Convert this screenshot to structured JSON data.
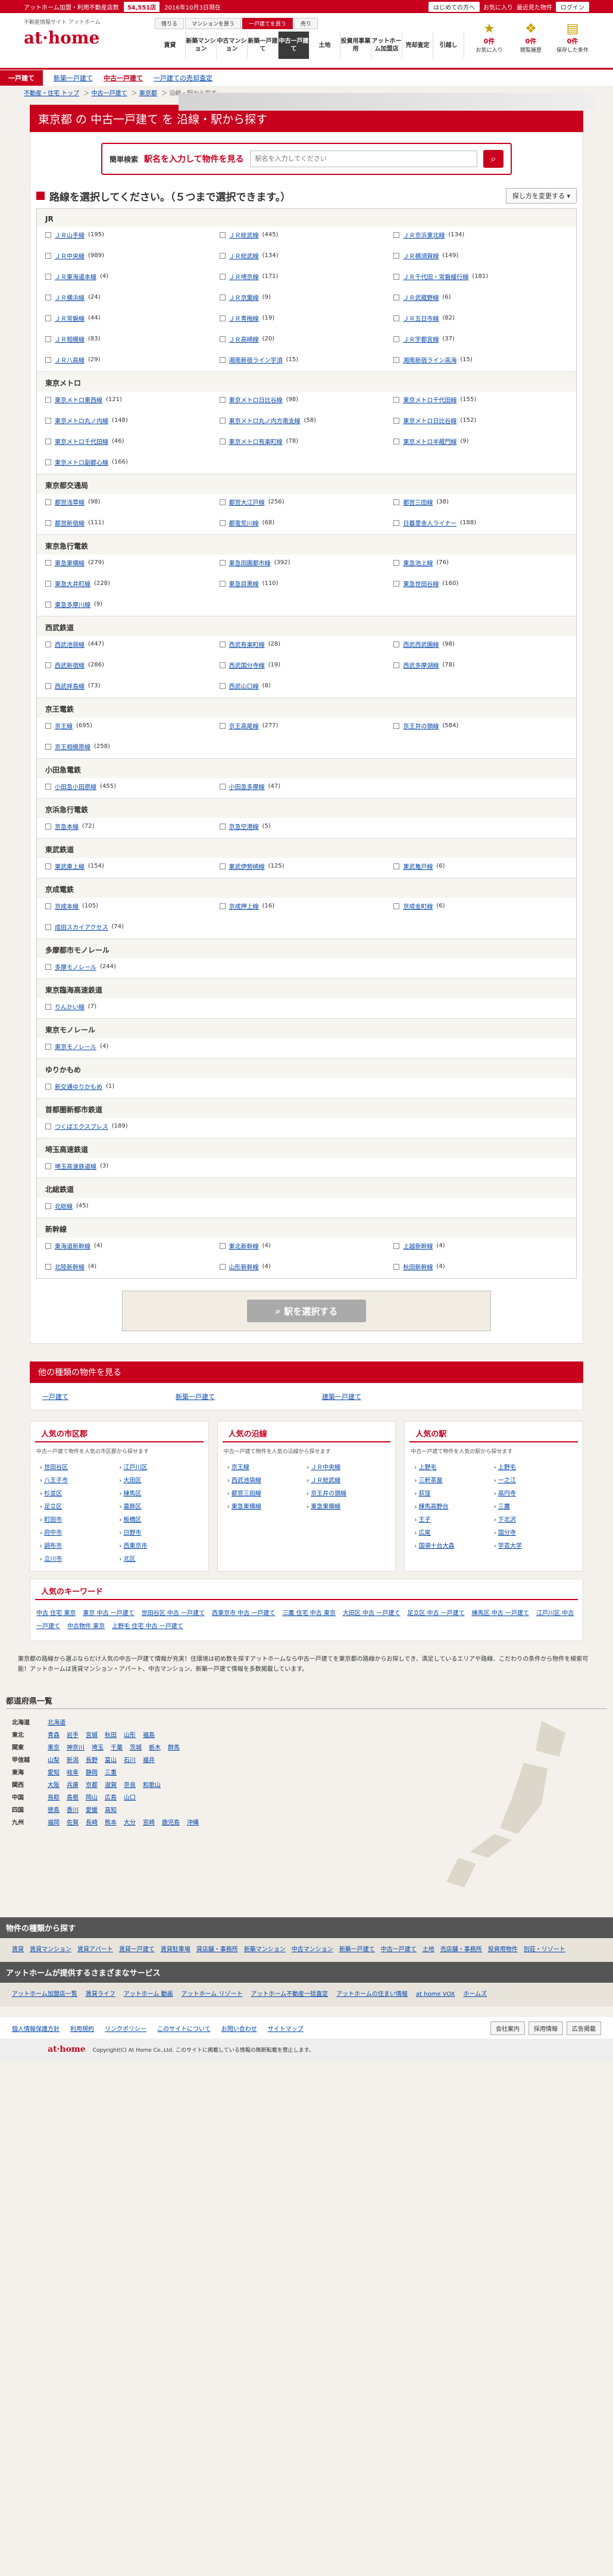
{
  "topbar": {
    "label": "アットホーム加盟・利用不動産店数",
    "count": "54,551店",
    "date": "2016年10月3日現在",
    "links": [
      "はじめての方へ",
      "お気に入り",
      "最近見た物件",
      "ログイン"
    ]
  },
  "header": {
    "sub": "不動産情報サイト アットホーム",
    "logo": "at·home",
    "top_tabs": [
      "借りる",
      "マンションを買う",
      "一戸建てを買う",
      "売り"
    ],
    "main_tabs": [
      "賃貸",
      "新築マンション",
      "中古マンション",
      "新築一戸建て",
      "中古一戸建て",
      "土地",
      "投資用事業用",
      "アットホーム加盟店",
      "売却査定",
      "引越し"
    ],
    "icons": [
      {
        "name": "お気に入り",
        "count": "0件"
      },
      {
        "name": "閲覧履歴",
        "count": "0件"
      },
      {
        "name": "保存した条件",
        "count": "0件"
      }
    ]
  },
  "subnav": {
    "tag": "一戸建て",
    "items": [
      "新築一戸建て",
      "中古一戸建て",
      "一戸建ての売却査定"
    ]
  },
  "breadcrumb": [
    "不動産・住宅 トップ",
    "中古一戸建て",
    "東京都",
    "沿線・駅から探す"
  ],
  "title": "東京都 の 中古一戸建て を 沿線・駅から探す",
  "search": {
    "label": "簡単検索",
    "label2": "駅名を入力して物件を見る",
    "placeholder": "駅名を入力してください"
  },
  "select": {
    "title": "路線を選択してください。（５つまで選択できます。）",
    "sort": "探し方を変更する"
  },
  "companies": [
    {
      "name": "JR",
      "lines": [
        [
          "ＪＲ山手線",
          "195"
        ],
        [
          "ＪＲ総武線",
          "445"
        ],
        [
          "ＪＲ京浜東北線",
          "134"
        ],
        [
          "ＪＲ中央線",
          "989"
        ],
        [
          "ＪＲ総武線",
          "134"
        ],
        [
          "ＪＲ横須賀線",
          "149"
        ],
        [
          "ＪＲ東海道本線",
          "4"
        ],
        [
          "ＪＲ埼京線",
          "171"
        ],
        [
          "ＪＲ千代田・常磐緩行線",
          "181"
        ],
        [
          "ＪＲ横浜線",
          "24"
        ],
        [
          "ＪＲ京葉線",
          "9"
        ],
        [
          "ＪＲ武蔵野線",
          "6"
        ],
        [
          "ＪＲ常磐線",
          "44"
        ],
        [
          "ＪＲ青梅線",
          "19"
        ],
        [
          "ＪＲ五日市線",
          "82"
        ],
        [
          "ＪＲ相模線",
          "83"
        ],
        [
          "ＪＲ高崎線",
          "20"
        ],
        [
          "ＪＲ宇都宮線",
          "37"
        ],
        [
          "ＪＲ八高線",
          "29"
        ],
        [
          "湘南新宿ライン宇須",
          "15"
        ],
        [
          "湘南新宿ライン高海",
          "15"
        ]
      ]
    },
    {
      "name": "東京メトロ",
      "lines": [
        [
          "東京メトロ東西線",
          "121"
        ],
        [
          "東京メトロ日比谷線",
          "98"
        ],
        [
          "東京メトロ千代田線",
          "155"
        ],
        [
          "東京メトロ丸ノ内線",
          "148"
        ],
        [
          "東京メトロ丸ノ内方南支線",
          "58"
        ],
        [
          "東京メトロ日比谷線",
          "152"
        ],
        [
          "東京メトロ千代田線",
          "46"
        ],
        [
          "東京メトロ有楽町線",
          "78"
        ],
        [
          "東京メトロ半蔵門線",
          "9"
        ],
        [
          "東京メトロ副都心線",
          "166"
        ]
      ]
    },
    {
      "name": "東京都交通局",
      "lines": [
        [
          "都営浅草線",
          "98"
        ],
        [
          "都営大江戸線",
          "256"
        ],
        [
          "都営三田線",
          "38"
        ],
        [
          "都営新宿線",
          "111"
        ],
        [
          "都電荒川線",
          "68"
        ],
        [
          "日暮里舎人ライナー",
          "188"
        ]
      ]
    },
    {
      "name": "東京急行電鉄",
      "lines": [
        [
          "東急東横線",
          "279"
        ],
        [
          "東急田園都市線",
          "392"
        ],
        [
          "東急池上線",
          "76"
        ],
        [
          "東急大井町線",
          "228"
        ],
        [
          "東急目黒線",
          "110"
        ],
        [
          "東急世田谷線",
          "160"
        ],
        [
          "東急多摩川線",
          "9"
        ]
      ]
    },
    {
      "name": "西武鉄道",
      "lines": [
        [
          "西武池袋線",
          "447"
        ],
        [
          "西武有楽町線",
          "28"
        ],
        [
          "西武西武園線",
          "98"
        ],
        [
          "西武新宿線",
          "286"
        ],
        [
          "西武国分寺線",
          "19"
        ],
        [
          "西武多摩湖線",
          "78"
        ],
        [
          "西武拝島線",
          "73"
        ],
        [
          "西武山口線",
          "8"
        ]
      ]
    },
    {
      "name": "京王電鉄",
      "lines": [
        [
          "京王線",
          "695"
        ],
        [
          "京王高尾線",
          "277"
        ],
        [
          "京王井の頭線",
          "584"
        ],
        [
          "京王相模原線",
          "258"
        ]
      ]
    },
    {
      "name": "小田急電鉄",
      "lines": [
        [
          "小田急小田原線",
          "455"
        ],
        [
          "小田急多摩線",
          "47"
        ]
      ]
    },
    {
      "name": "京浜急行電鉄",
      "lines": [
        [
          "京急本線",
          "72"
        ],
        [
          "京急空港線",
          "5"
        ]
      ]
    },
    {
      "name": "東武鉄道",
      "lines": [
        [
          "東武東上線",
          "154"
        ],
        [
          "東武伊勢崎線",
          "125"
        ],
        [
          "東武亀戸線",
          "6"
        ]
      ]
    },
    {
      "name": "京成電鉄",
      "lines": [
        [
          "京成本線",
          "105"
        ],
        [
          "京成押上線",
          "16"
        ],
        [
          "京成金町線",
          "6"
        ],
        [
          "成田スカイアクセス",
          "74"
        ]
      ]
    },
    {
      "name": "多摩都市モノレール",
      "lines": [
        [
          "多摩モノレール",
          "244"
        ]
      ]
    },
    {
      "name": "東京臨海高速鉄道",
      "lines": [
        [
          "りんかい線",
          "7"
        ]
      ]
    },
    {
      "name": "東京モノレール",
      "lines": [
        [
          "東京モノレール",
          "4"
        ]
      ]
    },
    {
      "name": "ゆりかもめ",
      "lines": [
        [
          "新交通ゆりかもめ",
          "1"
        ]
      ]
    },
    {
      "name": "首都圏新都市鉄道",
      "lines": [
        [
          "つくばエクスプレス",
          "189"
        ]
      ]
    },
    {
      "name": "埼玉高速鉄道",
      "lines": [
        [
          "埼玉高速鉄道線",
          "3"
        ]
      ]
    },
    {
      "name": "北総鉄道",
      "lines": [
        [
          "北総線",
          "45"
        ]
      ]
    },
    {
      "name": "新幹線",
      "lines": [
        [
          "東海道新幹線",
          "4"
        ],
        [
          "東北新幹線",
          "4"
        ],
        [
          "上越新幹線",
          "4"
        ],
        [
          "北陸新幹線",
          "4"
        ],
        [
          "山形新幹線",
          "4"
        ],
        [
          "秋田新幹線",
          "4"
        ]
      ]
    }
  ],
  "submit": "駅を選択する",
  "other": {
    "title": "他の種類の物件を見る",
    "items": [
      "一戸建て",
      "新築一戸建て",
      "建築一戸建て"
    ]
  },
  "popular": [
    {
      "title": "人気の市区郡",
      "desc": "中古一戸建て物件を人気の市区郡から探せます",
      "items": [
        "世田谷区",
        "江戸川区",
        "八王子市",
        "大田区",
        "杉並区",
        "練馬区",
        "足立区",
        "葛飾区",
        "町田市",
        "板橋区",
        "府中市",
        "日野市",
        "調布市",
        "西東京市",
        "立川市",
        "北区"
      ]
    },
    {
      "title": "人気の沿線",
      "desc": "中古一戸建て物件を人気の沿線から探せます",
      "items": [
        "京王線",
        "ＪＲ中央線",
        "西武池袋線",
        "ＪＲ総武線",
        "都営三田線",
        "京王井の頭線",
        "東急東横線",
        "東急東横線"
      ]
    },
    {
      "title": "人気の駅",
      "desc": "中古一戸建て物件を人気の駅から探せます",
      "items": [
        "上野毛",
        "上野毛",
        "三軒茶屋",
        "一之江",
        "荻窪",
        "高円寺",
        "練馬高野台",
        "三鷹",
        "王子",
        "下北沢",
        "広尾",
        "国分寺",
        "国領十台大森",
        "学芸大学"
      ]
    }
  ],
  "keywords": {
    "title": "人気のキーワード",
    "items": [
      "中古 住宅 東京",
      "東京 中古 一戸建て",
      "世田谷区 中古 一戸建て",
      "西東京市 中古 一戸建て",
      "三鷹 住宅 中古 東京",
      "大田区 中古 一戸建て",
      "足立区 中古 一戸建て",
      "練馬区 中古 一戸建て",
      "江戸川区 中古 一戸建て",
      "中古物件 東京",
      "上野毛 住宅 中古 一戸建て"
    ]
  },
  "note": "東京都の路線から選ぶならだけ人気の中古一戸建て情報が充実！住環境は初め数を探すアットホームなら中古一戸建てを東京都の路線からお探しでき、満足しているエリアや路線、こだわりの条件から物件を検索可能！アットホームは賃貸マンション・アパート、中古マンション、新築一戸建て情報を多数掲載しています。",
  "prefectures": {
    "title": "都道府県一覧",
    "rows": [
      {
        "region": "北海道",
        "items": [
          "北海道"
        ]
      },
      {
        "region": "東北",
        "items": [
          "青森",
          "岩手",
          "宮城",
          "秋田",
          "山形",
          "福島"
        ]
      },
      {
        "region": "関東",
        "items": [
          "東京",
          "神奈川",
          "埼玉",
          "千葉",
          "茨城",
          "栃木",
          "群馬"
        ]
      },
      {
        "region": "甲信越",
        "items": [
          "山梨",
          "新潟",
          "長野",
          "富山",
          "石川",
          "福井"
        ]
      },
      {
        "region": "東海",
        "items": [
          "愛知",
          "岐阜",
          "静岡",
          "三重"
        ]
      },
      {
        "region": "関西",
        "items": [
          "大阪",
          "兵庫",
          "京都",
          "滋賀",
          "奈良",
          "和歌山"
        ]
      },
      {
        "region": "中国",
        "items": [
          "鳥取",
          "島根",
          "岡山",
          "広島",
          "山口"
        ]
      },
      {
        "region": "四国",
        "items": [
          "徳島",
          "香川",
          "愛媛",
          "高知"
        ]
      },
      {
        "region": "九州",
        "items": [
          "福岡",
          "佐賀",
          "長崎",
          "熊本",
          "大分",
          "宮崎",
          "鹿児島",
          "沖縄"
        ]
      }
    ]
  },
  "types": {
    "title": "物件の種類から探す",
    "items": [
      "賃貸",
      "賃貸マンション",
      "賃貸アパート",
      "賃貸一戸建て",
      "賃貸駐車場",
      "貸店舗・事務所",
      "新築マンション",
      "中古マンション",
      "新築一戸建て",
      "中古一戸建て",
      "土地",
      "売店舗・事務所",
      "投資用物件",
      "別荘・リゾート"
    ]
  },
  "services": {
    "title": "アットホームが提供するさまざまなサービス",
    "items": [
      "アットホーム加盟店一覧",
      "賃貸ライフ",
      "アットホーム 動画",
      "アットホーム リゾート",
      "アットホーム不動産一括査定",
      "アットホームの住まい情報",
      "at home VOX",
      "ホームズ"
    ]
  },
  "footer": {
    "links": [
      "個人情報保護方針",
      "利用規約",
      "リンクポリシー",
      "このサイトについて",
      "お問い合わせ",
      "サイトマップ"
    ],
    "buttons": [
      "会社案内",
      "採用情報",
      "広告掲載"
    ],
    "logo": "at·home",
    "copyright": "Copyright(C) At Home Co.,Ltd. このサイトに掲載している情報の無断転載を禁止します。"
  }
}
